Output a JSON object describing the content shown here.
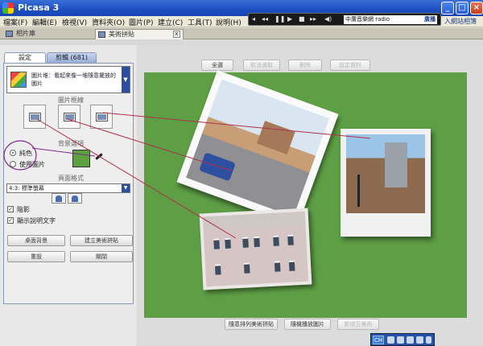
{
  "window": {
    "title": "Picasa 3"
  },
  "menu": {
    "items": [
      "檔案(F)",
      "編輯(E)",
      "檢視(V)",
      "資料夾(O)",
      "圖片(P)",
      "建立(C)",
      "工具(T)",
      "說明(H)"
    ],
    "extra_link": "入網站相簿"
  },
  "player": {
    "station": "中廣音樂網 radio",
    "go_label": "廣播"
  },
  "tabs": {
    "library": "相片庫",
    "collage": "美術拼貼"
  },
  "left_panel": {
    "tab_settings": "設定",
    "tab_clips": "剪輯 (681)",
    "mode_text": "圖片堆：看起來像一堆隨意擺放的圖片",
    "border_section": "圖片框線",
    "background_section": "背景選項",
    "radio_solid": "純色",
    "radio_image": "使用圖片",
    "page_format_section": "頁面格式",
    "aspect_value": "4:3: 標準螢幕",
    "shadow_label": "陰影",
    "caption_label": "顯示說明文字",
    "btn_desktop": "桌面背景",
    "btn_create": "建立美術拼貼",
    "btn_reset": "重設",
    "btn_close": "關閉",
    "swatch_color": "#5da040"
  },
  "toolbar_top": {
    "btn_all": "全選",
    "btn_clear": "取消選取",
    "btn_delete": "刪除",
    "btn_rotate": "設定資料"
  },
  "toolbar_bottom": {
    "btn_shuffle": "隨意排列美術拼貼",
    "btn_random": "隨機播放圖片",
    "btn_add": "新增至美術"
  },
  "canvas": {
    "background": "#5e9f45"
  },
  "taskbar": {
    "ime": "CH"
  }
}
